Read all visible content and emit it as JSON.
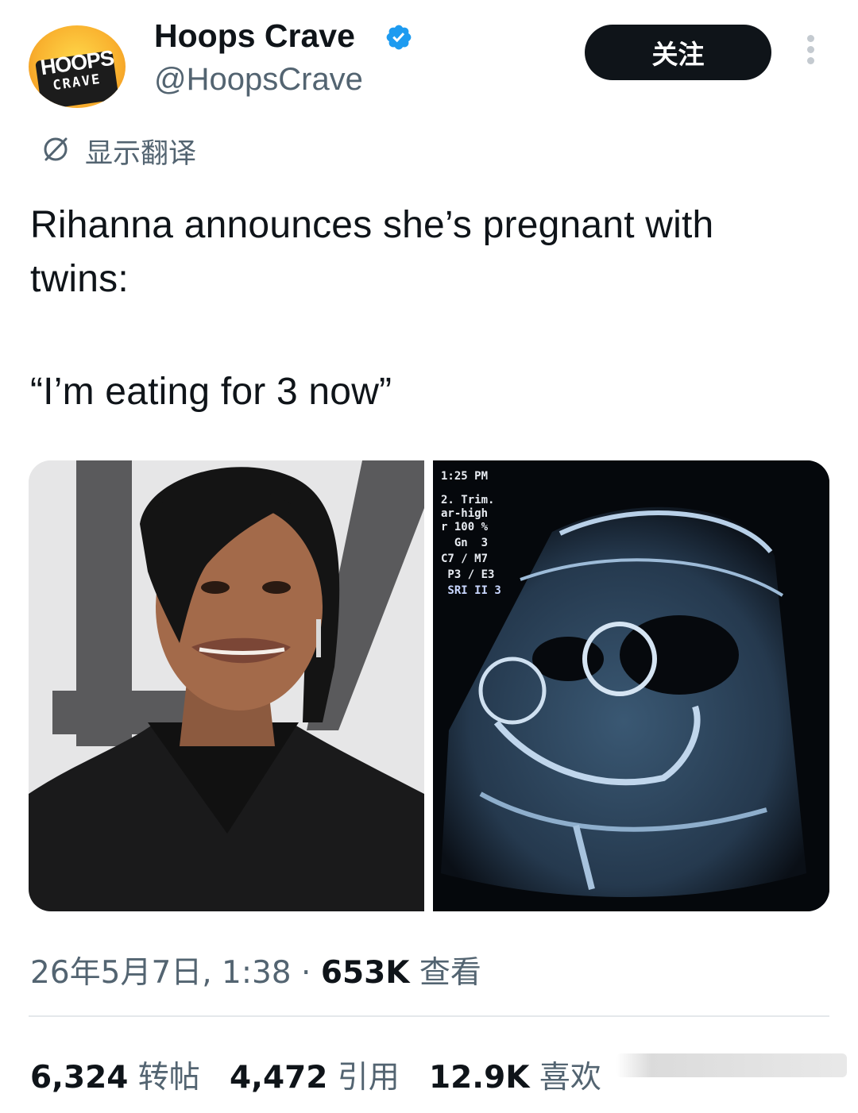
{
  "author": {
    "display_name": "Hoops Crave",
    "handle": "@HoopsCrave",
    "avatar_logo_line1": "HOOPS",
    "avatar_logo_line2": "CRAVE",
    "verified": true,
    "verified_color": "#1d9bf0"
  },
  "header": {
    "follow_label": "关注",
    "more_icon": "more-vertical-icon"
  },
  "translate": {
    "icon": "globe-slash-icon",
    "label": "显示翻译"
  },
  "tweet": {
    "text_line1": "Rihanna announces she’s pregnant with",
    "text_line2": "twins:",
    "quote_line": "“I’m eating for 3 now”"
  },
  "media": {
    "left_image": "photo-of-woman-smiling",
    "right_image": "ultrasound-scan",
    "ultrasound_overlay": {
      "time": "1:25 PM",
      "lines": [
        "2. Trim.",
        "ar-high",
        "r 100 %",
        "  Gn  3",
        "C7 / M7",
        " P3 / E3",
        " SRI II 3"
      ]
    }
  },
  "meta": {
    "timestamp": "26年5月7日, 1:38",
    "separator": "·",
    "views_count": "653K",
    "views_label": "查看"
  },
  "stats": {
    "reposts_count": "6,324",
    "reposts_label": "转帖",
    "quotes_count": "4,472",
    "quotes_label": "引用",
    "likes_count": "12.9K",
    "likes_label": "喜欢"
  },
  "colors": {
    "text_primary": "#0f1419",
    "text_secondary": "#536471",
    "follow_bg": "#0f1419",
    "divider": "#e4e8eb"
  }
}
